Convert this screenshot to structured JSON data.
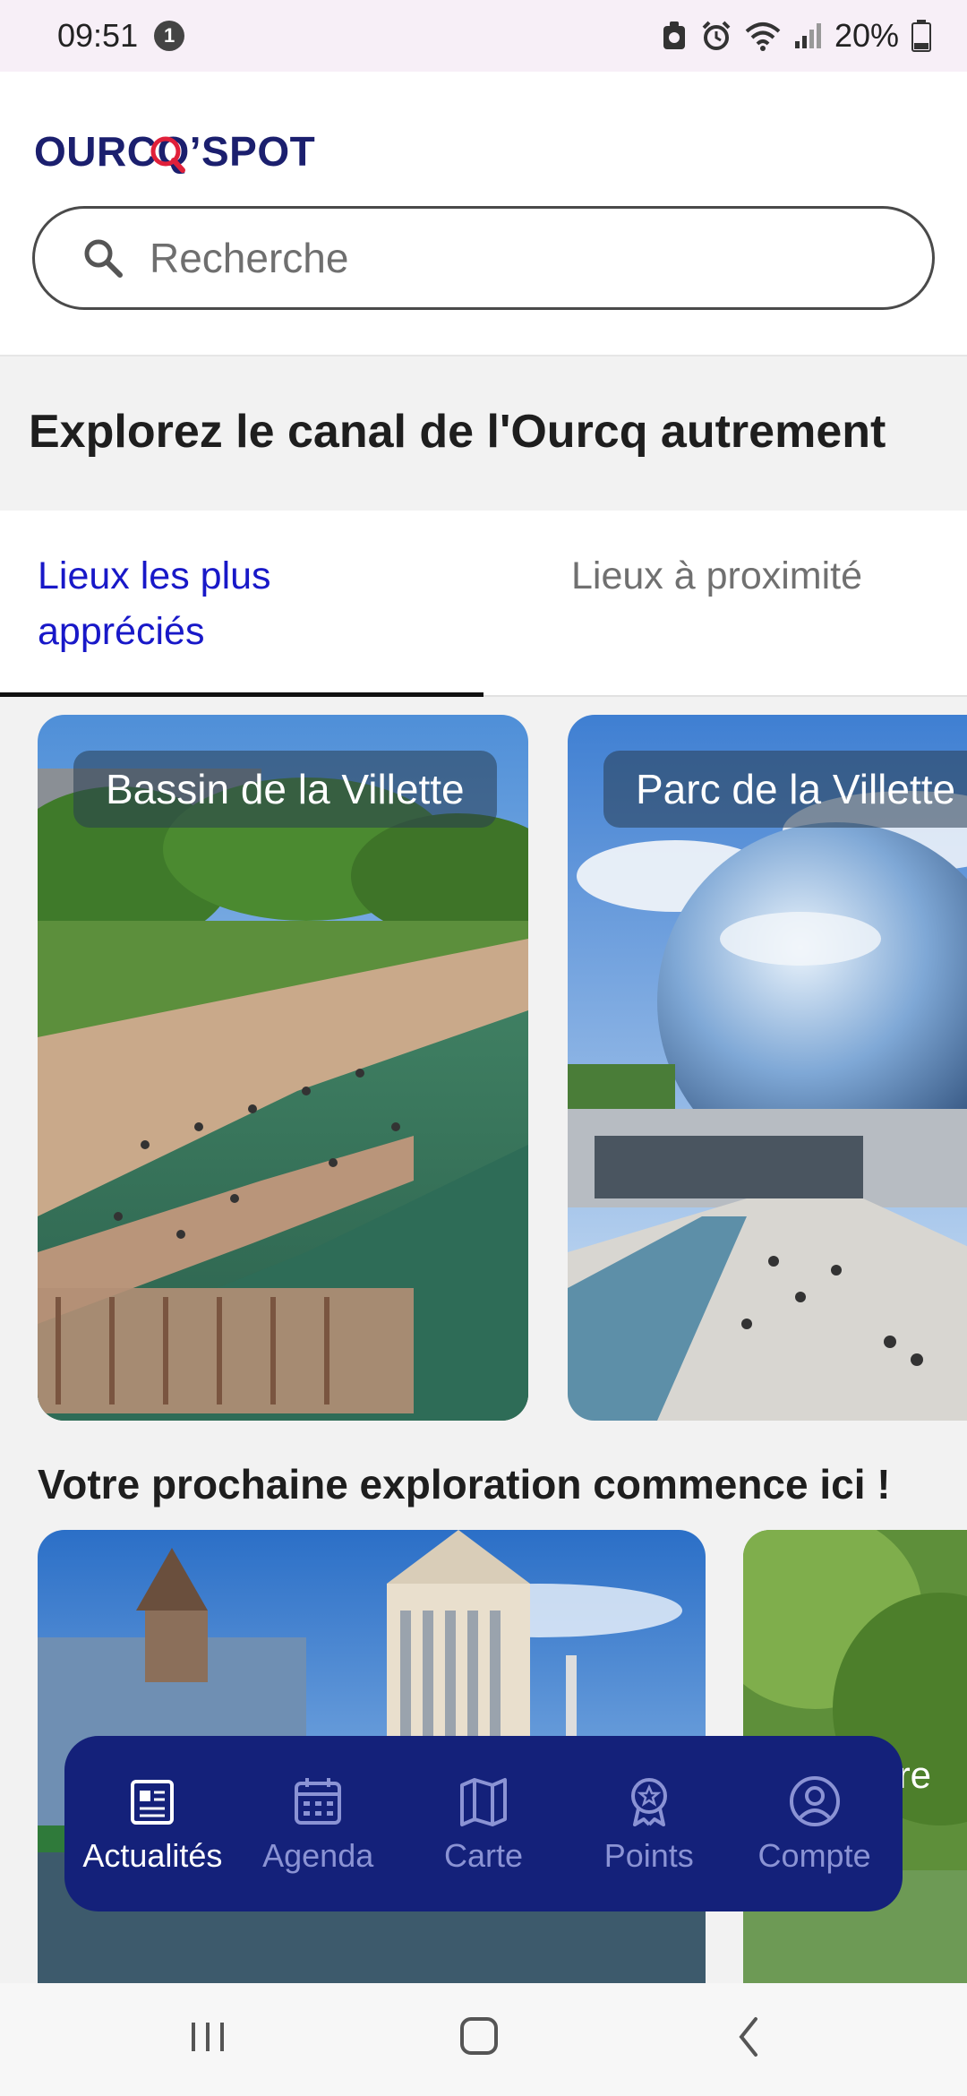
{
  "status_bar": {
    "time": "09:51",
    "notification_count": "1",
    "battery": "20%"
  },
  "header": {
    "logo_text": "OURCQ’SPOT",
    "search_placeholder": "Recherche"
  },
  "hero": {
    "title": "Explorez le canal de l'Ourcq autrement"
  },
  "tabs": [
    {
      "label": "Lieux les plus appréciés",
      "active": true
    },
    {
      "label": "Lieux à proximité",
      "active": false
    }
  ],
  "places": [
    {
      "name": "Bassin de la Villette"
    },
    {
      "name": "Parc de la Villette"
    }
  ],
  "section": {
    "title": "Votre prochaine exploration commence ici !"
  },
  "explore_cards": [
    {
      "label": ""
    },
    {
      "label": "lore"
    }
  ],
  "bottom_nav": [
    {
      "label": "Actualités",
      "icon": "newspaper-icon",
      "active": true
    },
    {
      "label": "Agenda",
      "icon": "calendar-icon",
      "active": false
    },
    {
      "label": "Carte",
      "icon": "map-icon",
      "active": false
    },
    {
      "label": "Points",
      "icon": "award-icon",
      "active": false
    },
    {
      "label": "Compte",
      "icon": "account-icon",
      "active": false
    }
  ],
  "colors": {
    "brand_navy": "#14217a",
    "logo_navy": "#1b1f6e",
    "accent_red": "#e0203a",
    "active_tab": "#1818c8"
  }
}
